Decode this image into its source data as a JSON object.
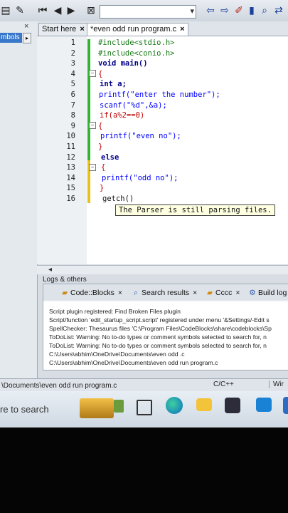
{
  "left_pane": {
    "tab_label": "mbols",
    "tab_arrow": "▸",
    "close": "×"
  },
  "editor_tabs": [
    {
      "label": "Start here",
      "close": "×"
    },
    {
      "label": "*even odd run program.c",
      "close": "×"
    }
  ],
  "code_lines": [
    {
      "ln": "1",
      "text": "#include<stdio.h>"
    },
    {
      "ln": "2",
      "text": "#include<conio.h>"
    },
    {
      "ln": "3",
      "text": "void main()"
    },
    {
      "ln": "4",
      "text": "{"
    },
    {
      "ln": "5",
      "text": "int a;"
    },
    {
      "ln": "6",
      "text": "printf(\"enter the number\");"
    },
    {
      "ln": "7",
      "text": "scanf(\"%d\",&a);"
    },
    {
      "ln": "8",
      "text": "if(a%2==0)"
    },
    {
      "ln": "9",
      "text": "{"
    },
    {
      "ln": "10",
      "text": "printf(\"even no\");"
    },
    {
      "ln": "11",
      "text": "}"
    },
    {
      "ln": "12",
      "text": "else"
    },
    {
      "ln": "13",
      "text": "{"
    },
    {
      "ln": "14",
      "text": "printf(\"odd no\");"
    },
    {
      "ln": "15",
      "text": "}"
    },
    {
      "ln": "16",
      "text": "getch()"
    }
  ],
  "tooltip": "The Parser is still parsing files.",
  "logs": {
    "title": "Logs & others",
    "tabs": [
      {
        "label": "Code::Blocks",
        "close": "×"
      },
      {
        "label": "Search results",
        "close": "×"
      },
      {
        "label": "Cccc",
        "close": "×"
      },
      {
        "label": "Build log",
        "close": ""
      }
    ],
    "lines": [
      "Script plugin registered: Find Broken Files plugin",
      "Script/function 'edit_startup_script.script' registered under menu '&Settings/-Edit s",
      "SpellChecker: Thesaurus files 'C:\\Program Files\\CodeBlocks\\share\\codeblocks\\Sp",
      "ToDoList: Warning: No to-do types or comment symbols selected to search for, n",
      "ToDoList: Warning: No to-do types or comment symbols selected to search for, n",
      "C:\\Users\\abhim\\OneDrive\\Documents\\even odd .c",
      "C:\\Users\\abhim\\OneDrive\\Documents\\even odd run program.c"
    ]
  },
  "statusbar": {
    "path": "\\Documents\\even odd run program.c",
    "language": "C/C++",
    "extra": "Wir"
  },
  "taskbar": {
    "search_placeholder": "re to search"
  }
}
